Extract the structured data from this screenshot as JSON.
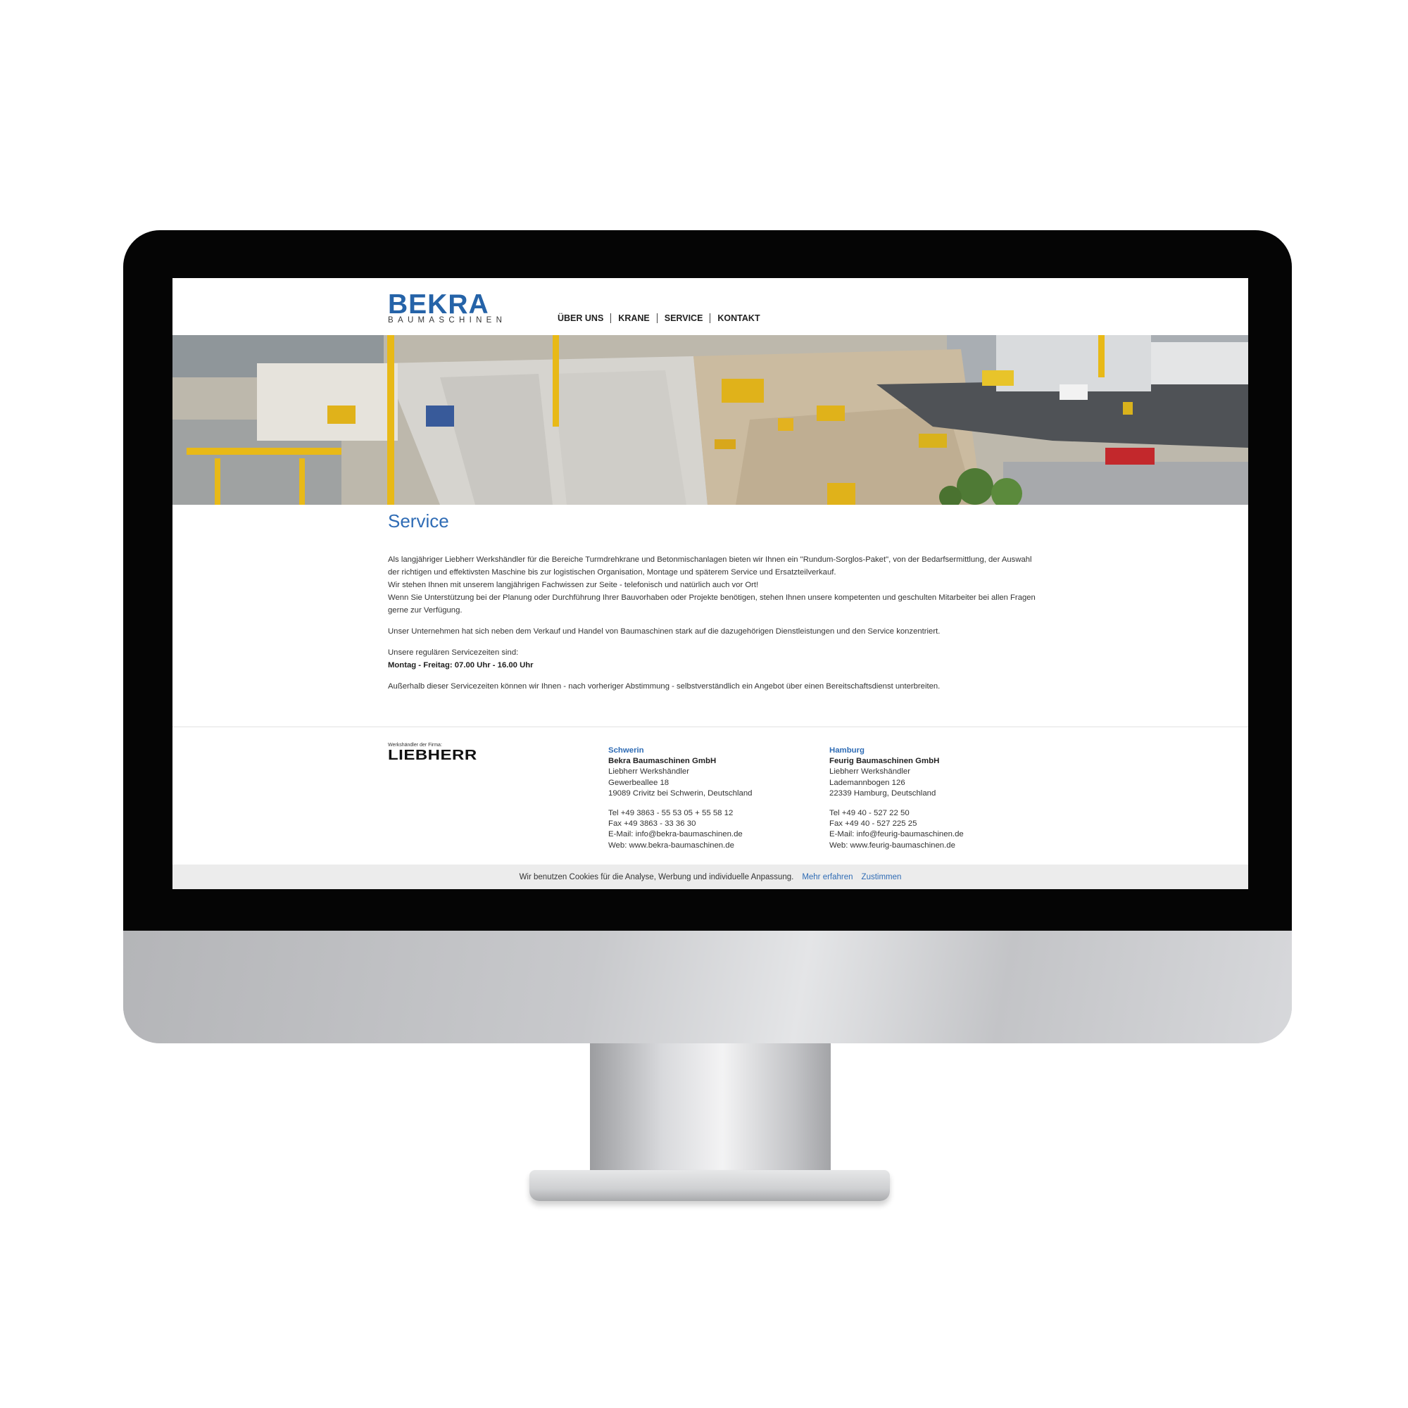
{
  "header": {
    "logo": {
      "name": "BEKRA",
      "subtitle": "BAUMASCHINEN"
    },
    "nav": [
      {
        "label": "ÜBER UNS"
      },
      {
        "label": "KRANE"
      },
      {
        "label": "SERVICE"
      },
      {
        "label": "KONTAKT"
      }
    ]
  },
  "hero": {
    "image": "construction-site-photo"
  },
  "main": {
    "title": "Service",
    "paragraphs": [
      "Als langjähriger Liebherr Werkshändler für die Bereiche Turmdrehkrane und Betonmischanlagen bieten wir Ihnen ein \"Rundum-Sorglos-Paket\", von der Bedarfsermittlung, der Auswahl der richtigen und effektivsten Maschine bis zur logistischen Organisation, Montage und späterem Service und Ersatzteilverkauf.",
      "Wir stehen Ihnen mit unserem langjährigen Fachwissen zur Seite - telefonisch und natürlich auch vor Ort!",
      "Wenn Sie Unterstützung bei der Planung oder Durchführung Ihrer Bauvorhaben oder Projekte benötigen, stehen Ihnen unsere kompetenten und geschulten Mitarbeiter bei allen Fragen gerne zur Verfügung.",
      "Unser Unternehmen hat sich neben dem Verkauf und Handel von Baumaschinen stark auf die dazugehörigen Dienstleistungen und den Service konzentriert."
    ],
    "hours_intro": "Unsere regulären Servicezeiten sind:",
    "hours": "Montag - Freitag: 07.00 Uhr - 16.00 Uhr",
    "outside_hours": "Außerhalb dieser Servicezeiten können wir Ihnen - nach vorheriger Abstimmung - selbstverständlich ein Angebot über einen Bereitschaftsdienst unterbreiten."
  },
  "footer": {
    "dealer_caption": "Werkshändler der Firma:",
    "dealer_brand": "LIEBHERR",
    "locations": [
      {
        "city": "Schwerin",
        "company": "Bekra Baumaschinen GmbH",
        "line1": "Liebherr Werkshändler",
        "street": "Gewerbeallee 18",
        "postal": "19089 Crivitz bei Schwerin, Deutschland",
        "tel": "Tel +49 3863 - 55 53 05 + 55 58 12",
        "fax": "Fax +49 3863 - 33 36 30",
        "email": "E-Mail: info@bekra-baumaschinen.de",
        "web": "Web: www.bekra-baumaschinen.de"
      },
      {
        "city": "Hamburg",
        "company": "Feurig Baumaschinen GmbH",
        "line1": "Liebherr Werkshändler",
        "street": "Lademannbogen 126",
        "postal": "22339 Hamburg, Deutschland",
        "tel": "Tel +49 40 - 527 22 50",
        "fax": "Fax +49 40 - 527 225 25",
        "email": "E-Mail: info@feurig-baumaschinen.de",
        "web": "Web: www.feurig-baumaschinen.de"
      }
    ]
  },
  "cookie": {
    "text": "Wir benutzen Cookies für die Analyse, Werbung und individuelle Anpassung.",
    "more": "Mehr erfahren",
    "accept": "Zustimmen"
  },
  "colors": {
    "brand_blue": "#2563a8",
    "link_blue": "#2f6cb5",
    "crane_yellow": "#e8b917"
  }
}
